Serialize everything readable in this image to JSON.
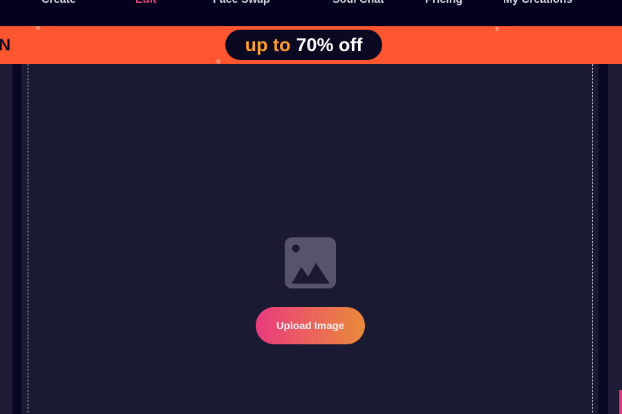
{
  "nav": {
    "items": [
      {
        "label": "Create"
      },
      {
        "label": "Edit",
        "active": true
      },
      {
        "label": "Face Swap"
      },
      {
        "label": "Soul Chat"
      },
      {
        "label": "Pricing"
      },
      {
        "label": "My Creations"
      }
    ],
    "active_color": "#e8447a"
  },
  "banner": {
    "left_text": "N",
    "promo_prefix": "up to",
    "promo_value": "70% off",
    "background": "#ff5630",
    "prefix_color": "#ff9f2e"
  },
  "upload": {
    "icon": "image-placeholder-icon",
    "button_label": "Upload Image",
    "button_gradient": [
      "#e93a7d",
      "#e98a3a"
    ]
  },
  "colors": {
    "page_bg": "#1b1a33",
    "nav_bg": "#03011d"
  }
}
